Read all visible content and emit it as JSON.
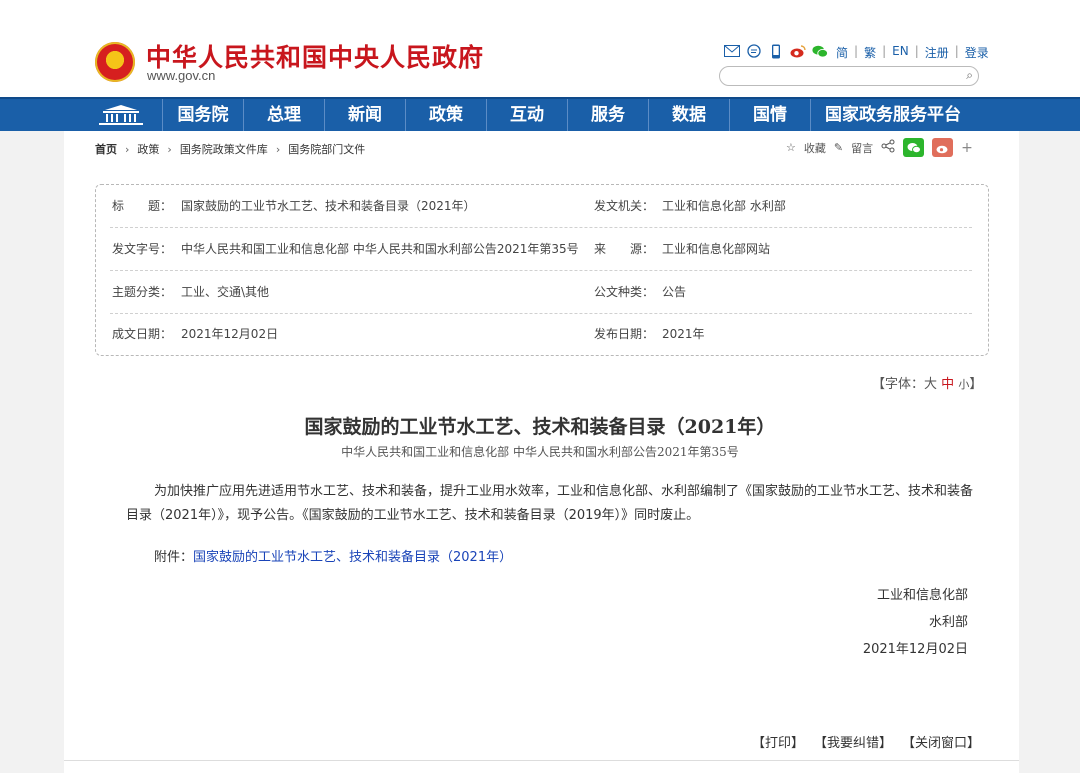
{
  "header": {
    "site_title": "中华人民共和国中央人民政府",
    "site_url": "www.gov.cn",
    "links": [
      "简",
      "繁",
      "EN",
      "注册",
      "登录"
    ],
    "icons": [
      "mail-icon",
      "message-icon",
      "mobile-icon",
      "weibo-icon",
      "wechat-icon"
    ],
    "search_placeholder": ""
  },
  "nav": {
    "items": [
      "国务院",
      "总理",
      "新闻",
      "政策",
      "互动",
      "服务",
      "数据",
      "国情",
      "国家政务服务平台"
    ]
  },
  "breadcrumb": {
    "items": [
      "首页",
      "政策",
      "国务院政策文件库",
      "国务院部门文件"
    ]
  },
  "share": {
    "collect": "收藏",
    "print_hint": "留言"
  },
  "meta": {
    "rows": [
      {
        "l1": "标　　题：",
        "v1": "国家鼓励的工业节水工艺、技术和装备目录（2021年）",
        "l2": "发文机关：",
        "v2": "工业和信息化部 水利部"
      },
      {
        "l1": "发文字号：",
        "v1": "中华人民共和国工业和信息化部 中华人民共和国水利部公告2021年第35号",
        "l2": "来　　源：",
        "v2": "工业和信息化部网站"
      },
      {
        "l1": "主题分类：",
        "v1": "工业、交通\\其他",
        "l2": "公文种类：",
        "v2": "公告"
      },
      {
        "l1": "成文日期：",
        "v1": "2021年12月02日",
        "l2": "发布日期：",
        "v2": "2021年"
      }
    ]
  },
  "font_size": {
    "prefix": "【字体：",
    "large": "大",
    "medium": "中",
    "small": "小",
    "suffix": "】"
  },
  "document": {
    "title": "国家鼓励的工业节水工艺、技术和装备目录（2021年）",
    "subtitle": "中华人民共和国工业和信息化部 中华人民共和国水利部公告2021年第35号",
    "body": "为加快推广应用先进适用节水工艺、技术和装备，提升工业用水效率，工业和信息化部、水利部编制了《国家鼓励的工业节水工艺、技术和装备目录（2021年）》，现予公告。《国家鼓励的工业节水工艺、技术和装备目录（2019年）》同时废止。",
    "attach_label": "附件：",
    "attach_link": "国家鼓励的工业节水工艺、技术和装备目录（2021年）",
    "sign1": "工业和信息化部",
    "sign2": "水利部",
    "sign_date": "2021年12月02日"
  },
  "actions": {
    "print": "【打印】",
    "correct": "【我要纠错】",
    "close": "【关闭窗口】"
  },
  "colors": {
    "brand_red": "#c8161d",
    "nav_blue": "#1a5fa8",
    "link_blue": "#1a44b8"
  }
}
